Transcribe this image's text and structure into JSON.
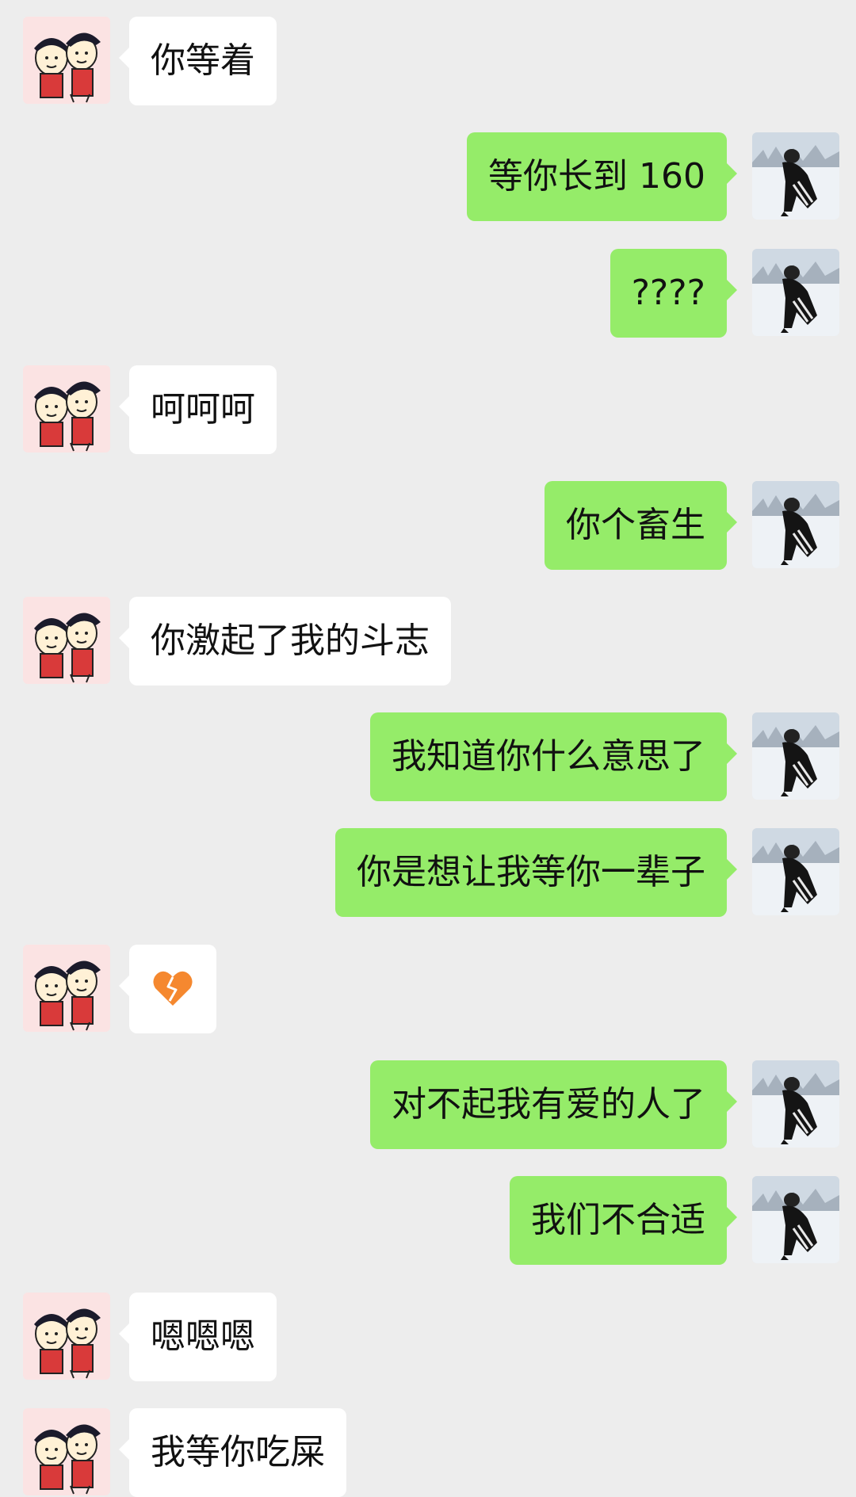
{
  "messages": [
    {
      "side": "left",
      "text": "你等着"
    },
    {
      "side": "right",
      "text": "等你长到 160"
    },
    {
      "side": "right",
      "text": "????"
    },
    {
      "side": "left",
      "text": "呵呵呵"
    },
    {
      "side": "right",
      "text": "你个畜生"
    },
    {
      "side": "left",
      "text": "你激起了我的斗志"
    },
    {
      "side": "right",
      "text": "我知道你什么意思了"
    },
    {
      "side": "right",
      "text": "你是想让我等你一辈子"
    },
    {
      "side": "left",
      "emoji": "broken-heart-icon"
    },
    {
      "side": "right",
      "text": "对不起我有爱的人了"
    },
    {
      "side": "right",
      "text": "我们不合适"
    },
    {
      "side": "left",
      "text": "嗯嗯嗯"
    },
    {
      "side": "left",
      "text": "我等你吃屎"
    }
  ],
  "avatars": {
    "left": "cartoon-couple-avatar",
    "right": "snow-photo-avatar"
  },
  "colors": {
    "background": "#ededed",
    "bubble_left": "#ffffff",
    "bubble_right": "#95ec69",
    "text": "#111111",
    "emoji": "#f5882f"
  }
}
